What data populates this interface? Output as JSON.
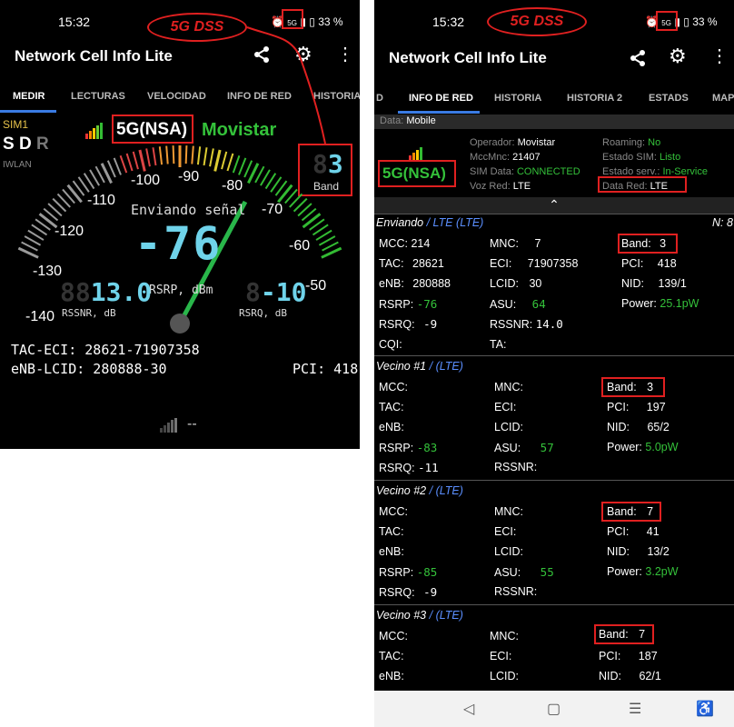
{
  "annotation": {
    "label": "5G DSS",
    "red": "#e02020"
  },
  "left": {
    "status": {
      "time": "15:32",
      "battery": "33 %",
      "net": "5G"
    },
    "app_title": "Network Cell Info Lite",
    "tabs": [
      "MEDIR",
      "LECTURAS",
      "VELOCIDAD",
      "INFO DE RED",
      "HISTORIA"
    ],
    "sim": "SIM1",
    "sdr_s": "S",
    "sdr_d": "D",
    "sdr_r": "R",
    "iwlan": "IWLAN",
    "network_type": "5G(NSA)",
    "operator": "Movistar",
    "band_value": "3",
    "band_label": "Band",
    "gauge_labels": [
      "-140",
      "-130",
      "-120",
      "-110",
      "-100",
      "-90",
      "-80",
      "-70",
      "-60",
      "-50"
    ],
    "sending": "Enviando señal",
    "rsrp_value": "-76",
    "rsrp_label": "RSRP, dBm",
    "rssnr_value": "13.0",
    "rssnr_label": "RSSNR, dB",
    "rsrq_value": "-10",
    "rsrq_label": "RSRQ, dB",
    "tac_eci": "TAC-ECI: 28621-71907358",
    "enb_lcid": "eNB-LCID: 280888-30",
    "pci": "PCI: 418",
    "second_signal": "--"
  },
  "right": {
    "status": {
      "time": "15:32",
      "battery": "33 %",
      "net": "5G"
    },
    "app_title": "Network Cell Info Lite",
    "tabs": [
      "D",
      "INFO DE RED",
      "HISTORIA",
      "HISTORIA 2",
      "ESTADS",
      "MAP"
    ],
    "data_label": "Data:",
    "data_value": "Mobile",
    "network_type": "5G(NSA)",
    "info": {
      "operador_l": "Operador:",
      "operador_v": "Movistar",
      "mccmnc_l": "MccMnc:",
      "mccmnc_v": "21407",
      "simdata_l": "SIM Data:",
      "simdata_v": "CONNECTED",
      "vozred_l": "Voz Red:",
      "vozred_v": "LTE",
      "roaming_l": "Roaming:",
      "roaming_v": "No",
      "estsim_l": "Estado SIM:",
      "estsim_v": "Listo",
      "estserv_l": "Estado serv.:",
      "estserv_v": "In-Service",
      "datared_l": "Data Red:",
      "datared_v": "LTE"
    },
    "serving": {
      "title": "Enviando",
      "tech": "/ LTE (LTE)",
      "n": "N: 8",
      "mcc": "214",
      "mnc": "7",
      "band": "3",
      "tac": "28621",
      "eci": "71907358",
      "pci": "418",
      "enb": "280888",
      "lcid": "30",
      "nid": "139/1",
      "rsrp": "-76",
      "asu": "64",
      "power": "25.1pW",
      "rsrq": "-9",
      "rssnr": "14.0",
      "cqi_l": "CQI:",
      "ta_l": "TA:"
    },
    "neighbors": [
      {
        "title": "Vecino #1",
        "tech": "/ (LTE)",
        "band": "3",
        "pci": "197",
        "nid": "65/2",
        "rsrp": "-83",
        "asu": "57",
        "power": "5.0pW",
        "rsrq": "-11"
      },
      {
        "title": "Vecino #2",
        "tech": "/ (LTE)",
        "band": "7",
        "pci": "41",
        "nid": "13/2",
        "rsrp": "-85",
        "asu": "55",
        "power": "3.2pW",
        "rsrq": "-9"
      },
      {
        "title": "Vecino #3",
        "tech": "/ (LTE)",
        "band": "7",
        "pci": "187",
        "nid": "62/1"
      }
    ],
    "labels": {
      "mcc": "MCC:",
      "mnc": "MNC:",
      "band": "Band:",
      "tac": "TAC:",
      "eci": "ECI:",
      "pci": "PCI:",
      "enb": "eNB:",
      "lcid": "LCID:",
      "nid": "NID:",
      "rsrp": "RSRP:",
      "asu": "ASU:",
      "power": "Power:",
      "rsrq": "RSRQ:",
      "rssnr": "RSSNR:"
    }
  }
}
